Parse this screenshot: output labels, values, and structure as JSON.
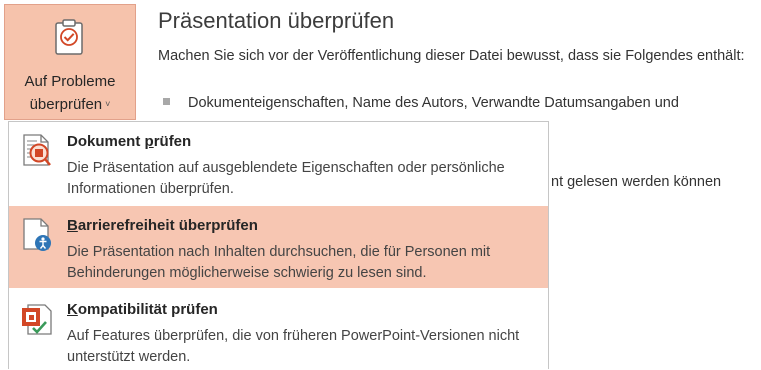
{
  "button": {
    "line1": "Auf Probleme",
    "line2": "überprüfen",
    "chevron": "˅",
    "icon": "checklist-icon"
  },
  "info": {
    "title": "Präsentation überprüfen",
    "description": "Machen Sie sich vor der Veröffentlichung dieser Datei bewusst, dass sie Folgendes enthält:",
    "bullet": "Dokumenteigenschaften, Name des Autors, Verwandte Datumsangaben und",
    "partial_text": "nt gelesen werden können"
  },
  "menu": {
    "items": [
      {
        "title_pre": "Dokument ",
        "title_u": "p",
        "title_post": "rüfen",
        "desc": "Die Präsentation auf ausgeblendete Eigenschaften oder persönliche Informationen überprüfen.",
        "icon": "document-inspector-icon"
      },
      {
        "title_pre": "",
        "title_u": "B",
        "title_post": "arrierefreiheit überprüfen",
        "desc": "Die Präsentation nach Inhalten durchsuchen, die für Personen mit Behinderungen möglicherweise schwierig zu lesen sind.",
        "icon": "accessibility-check-icon",
        "highlighted": true
      },
      {
        "title_pre": "",
        "title_u": "K",
        "title_post": "ompatibilität prüfen",
        "desc": "Auf Features überprüfen, die von früheren PowerPoint-Versionen nicht unterstützt werden.",
        "icon": "compatibility-check-icon"
      }
    ]
  },
  "colors": {
    "highlight": "#f7c6b2",
    "button_bg": "#f6c3ac",
    "accent_orange": "#d24726",
    "accent_blue": "#2e75b6"
  }
}
